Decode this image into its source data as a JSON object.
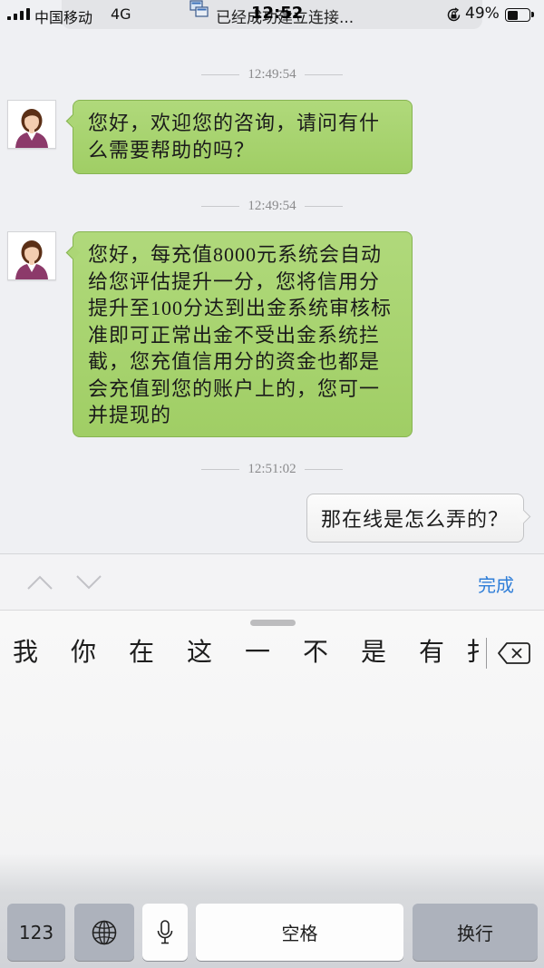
{
  "status_bar": {
    "carrier": "中国移动",
    "network": "4G",
    "time": "12:52",
    "notification": "已经成功建立连接...",
    "battery_percent": "49%",
    "battery_level": 0.49,
    "icons": {
      "signal": "signal-bars-icon",
      "notification": "remote-connection-icon",
      "rotation_lock": "rotation-lock-icon",
      "battery": "battery-icon"
    }
  },
  "chat": {
    "messages": [
      {
        "timestamp": "12:49:54",
        "lines": [
          "您好，欢迎您的咨询，请问有什",
          "么需要帮助的吗？"
        ]
      },
      {
        "timestamp": "12:49:54",
        "lines": [
          "您好，每充值8000元系统会自动",
          "给您评估提升一分，您将信用分",
          "提升至100分达到出金系统审核标",
          "准即可正常出金不受出金系统拦",
          "截，您充值信用分的资金也都是",
          "会充值到您的账户上的，您可一",
          "并提现的"
        ]
      },
      {
        "timestamp": "12:51:02",
        "lines": [
          "那在线是怎么弄的？"
        ]
      }
    ],
    "icons": {
      "avatar": "agent-avatar-icon"
    }
  },
  "input_toolbar": {
    "done_label": "完成",
    "icons": {
      "previous": "chevron-up-icon",
      "next": "chevron-down-icon"
    }
  },
  "keyboard": {
    "candidates": [
      "我",
      "你",
      "在",
      "这",
      "一",
      "不",
      "是",
      "有",
      "扌"
    ],
    "keys": {
      "numbers": "123",
      "space": "空格",
      "return": "换行"
    },
    "icons": {
      "delete": "delete-key-icon",
      "globe": "globe-icon",
      "mic": "microphone-icon"
    }
  },
  "colors": {
    "chat_background": "#eff0f3",
    "agent_bubble": "#a7d36f",
    "user_bubble": "#f6f6f6",
    "done_accent": "#2f7ed8",
    "keyboard_gray_key": "#adb2bc"
  }
}
